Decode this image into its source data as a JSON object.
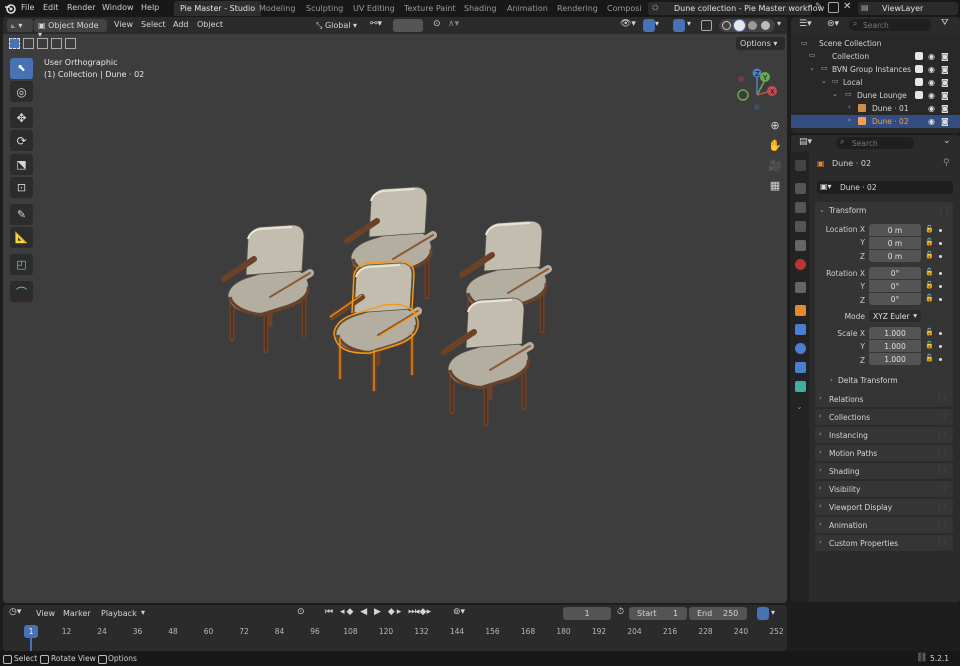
{
  "app": {
    "logo": "blender-logo-icon"
  },
  "menu": [
    "File",
    "Edit",
    "Render",
    "Window",
    "Help"
  ],
  "workspaces": [
    {
      "label": "Pie Master - Studio",
      "active": true
    },
    {
      "label": "Modeling",
      "active": false
    },
    {
      "label": "Sculpting",
      "active": false
    },
    {
      "label": "UV Editing",
      "active": false
    },
    {
      "label": "Texture Paint",
      "active": false
    },
    {
      "label": "Shading",
      "active": false
    },
    {
      "label": "Animation",
      "active": false
    },
    {
      "label": "Rendering",
      "active": false
    },
    {
      "label": "Composi",
      "active": false
    }
  ],
  "scene_field": "Dune collection - Pie Master workflow",
  "viewlayer_field": "ViewLayer",
  "search_placeholder": "Search",
  "viewport": {
    "mode": "Object Mode",
    "menus": [
      "View",
      "Select",
      "Add",
      "Object"
    ],
    "orientation": "Global",
    "options_label": "Options",
    "overlay_line1": "User Orthographic",
    "overlay_line2": "(1) Collection | Dune · 02",
    "gizmo_labels": {
      "x": "X",
      "y": "Y",
      "z": "Z"
    }
  },
  "outliner": {
    "rows": [
      {
        "label": "Scene Collection",
        "indent": 0,
        "checks": false
      },
      {
        "label": "Collection",
        "indent": 1,
        "checks": true
      },
      {
        "label": "BVN Group Instances",
        "indent": 1,
        "checks": true
      },
      {
        "label": "Local",
        "indent": 2,
        "checks": true
      },
      {
        "label": "Dune Lounge",
        "indent": 3,
        "checks": true
      },
      {
        "label": "Dune · 01",
        "indent": 4,
        "checks": false
      },
      {
        "label": "Dune · 02",
        "indent": 4,
        "checks": false,
        "selected": true
      }
    ]
  },
  "properties": {
    "search_placeholder": "Search",
    "object_name": "Dune · 02",
    "name_field": "Dune · 02",
    "transform_title": "Transform",
    "location_label": "Location X",
    "rotation_label": "Rotation X",
    "scale_label": "Scale X",
    "axis_y": "Y",
    "axis_z": "Z",
    "location": [
      "0 m",
      "0 m",
      "0 m"
    ],
    "rotation": [
      "0°",
      "0°",
      "0°"
    ],
    "scale": [
      "1.000",
      "1.000",
      "1.000"
    ],
    "mode_label": "Mode",
    "mode_value": "XYZ Euler",
    "delta_transform": "Delta Transform",
    "panels": [
      "Relations",
      "Collections",
      "Instancing",
      "Motion Paths",
      "Shading",
      "Visibility",
      "Viewport Display",
      "Animation",
      "Custom Properties"
    ]
  },
  "timeline": {
    "menus": [
      "View",
      "Marker",
      "Playback"
    ],
    "current_frame": "1",
    "start_label": "Start",
    "start_value": "1",
    "end_label": "End",
    "end_value": "250",
    "ticks": [
      "1",
      "12",
      "24",
      "36",
      "48",
      "60",
      "72",
      "84",
      "96",
      "108",
      "120",
      "132",
      "144",
      "156",
      "168",
      "180",
      "192",
      "204",
      "216",
      "228",
      "240",
      "252"
    ]
  },
  "status": {
    "select": "Select",
    "rotate": "Rotate View",
    "options": "Options",
    "version": "5.2.1"
  },
  "colors": {
    "accent": "#4772b3",
    "selection_outline": "#f49a1a",
    "chair_wood": "#7a4e30",
    "chair_cushion": "#b5b0a2"
  }
}
